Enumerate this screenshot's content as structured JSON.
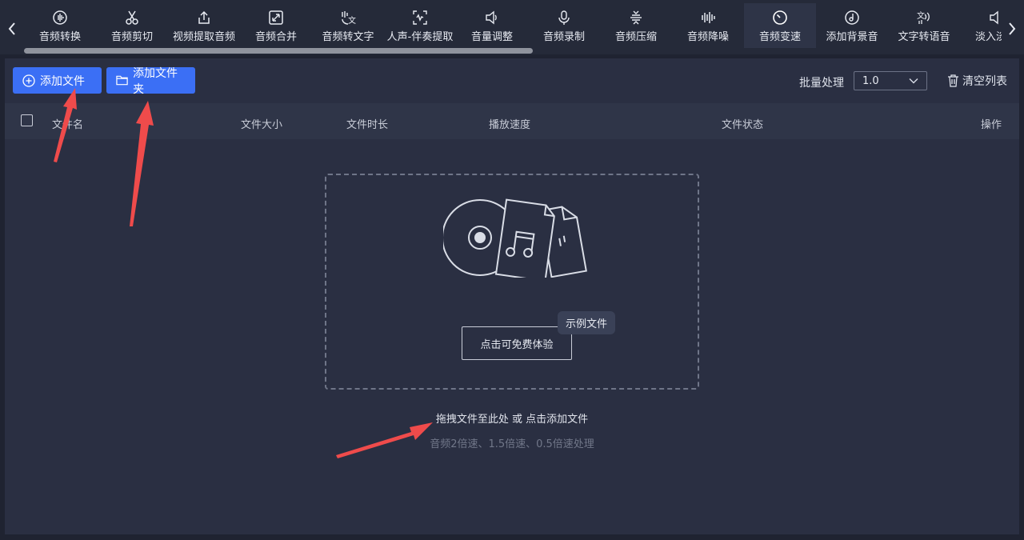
{
  "toolbar": {
    "tools": [
      {
        "label": "音频转换",
        "icon": "audio-convert-icon"
      },
      {
        "label": "音频剪切",
        "icon": "scissors-icon"
      },
      {
        "label": "视频提取音频",
        "icon": "upload-icon"
      },
      {
        "label": "音频合并",
        "icon": "merge-icon"
      },
      {
        "label": "音频转文字",
        "icon": "speech-to-text-icon"
      },
      {
        "label": "人声-伴奏提取",
        "icon": "voice-extract-icon"
      },
      {
        "label": "音量调整",
        "icon": "volume-icon"
      },
      {
        "label": "音频录制",
        "icon": "microphone-icon"
      },
      {
        "label": "音频压缩",
        "icon": "compress-icon"
      },
      {
        "label": "音频降噪",
        "icon": "waveform-icon"
      },
      {
        "label": "音频变速",
        "icon": "speed-dial-icon",
        "active": true
      },
      {
        "label": "添加背景音",
        "icon": "music-disc-icon"
      },
      {
        "label": "文字转语音",
        "icon": "text-to-speech-icon"
      },
      {
        "label": "淡入淡出",
        "icon": "fade-icon"
      }
    ]
  },
  "actions": {
    "add_file": "添加文件",
    "add_folder": "添加文件夹",
    "batch_label": "批量处理",
    "batch_value": "1.0",
    "clear_list": "清空列表"
  },
  "table": {
    "columns": [
      "文件名",
      "文件大小",
      "文件时长",
      "播放速度",
      "文件状态",
      "操作"
    ]
  },
  "dropzone": {
    "trial_button": "点击可免费体验",
    "sample_badge": "示例文件",
    "hint": "拖拽文件至此处 或 点击添加文件",
    "sub_hint": "音频2倍速、1.5倍速、0.5倍速处理"
  },
  "colors": {
    "accent": "#3b6ff5",
    "annotation_arrow": "#ef4b4b",
    "panel": "#2a2f42"
  }
}
